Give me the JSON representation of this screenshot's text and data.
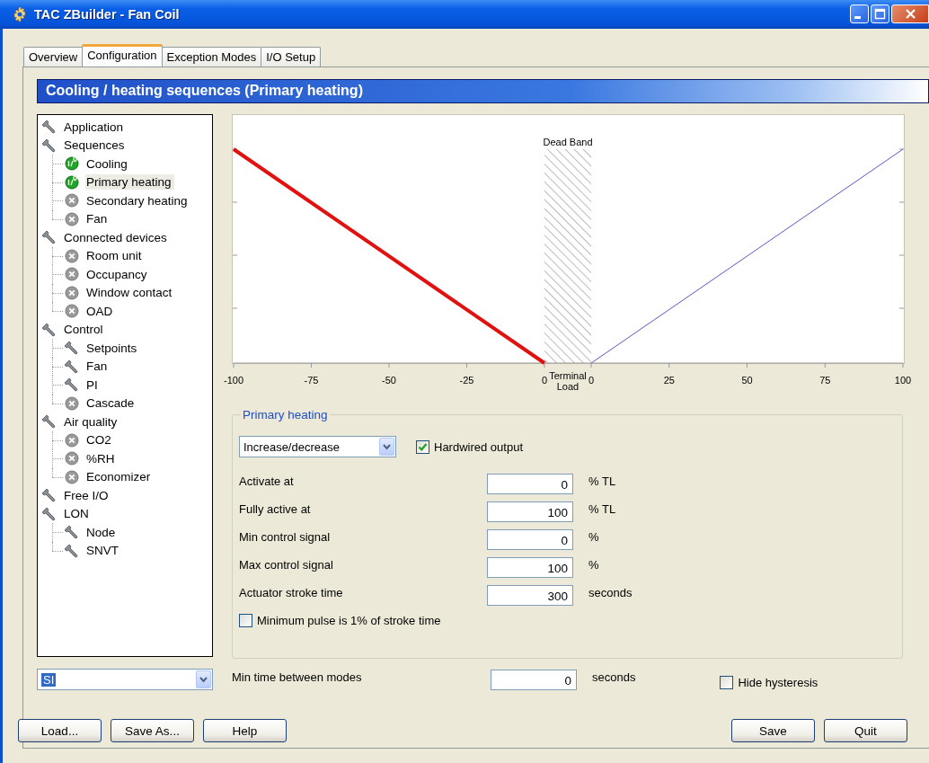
{
  "window": {
    "title": "TAC ZBuilder - Fan Coil"
  },
  "tabs": [
    {
      "label": "Overview",
      "selected": false
    },
    {
      "label": "Configuration",
      "selected": true
    },
    {
      "label": "Exception Modes",
      "selected": false
    },
    {
      "label": "I/O Setup",
      "selected": false
    }
  ],
  "section_header": "Cooling / heating sequences (Primary heating)",
  "tree": [
    {
      "label": "Application",
      "kind": "wrench",
      "selected": false
    },
    {
      "label": "Sequences",
      "kind": "wrench",
      "selected": false,
      "children": [
        {
          "label": "Cooling",
          "kind": "active",
          "selected": false
        },
        {
          "label": "Primary heating",
          "kind": "active",
          "selected": true
        },
        {
          "label": "Secondary heating",
          "kind": "inactive",
          "selected": false
        },
        {
          "label": "Fan",
          "kind": "inactive",
          "selected": false
        }
      ]
    },
    {
      "label": "Connected devices",
      "kind": "wrench",
      "selected": false,
      "children": [
        {
          "label": "Room unit",
          "kind": "inactive",
          "selected": false
        },
        {
          "label": "Occupancy",
          "kind": "inactive",
          "selected": false
        },
        {
          "label": "Window contact",
          "kind": "inactive",
          "selected": false
        },
        {
          "label": "OAD",
          "kind": "inactive",
          "selected": false
        }
      ]
    },
    {
      "label": "Control",
      "kind": "wrench",
      "selected": false,
      "children": [
        {
          "label": "Setpoints",
          "kind": "wrench",
          "selected": false
        },
        {
          "label": "Fan",
          "kind": "wrench",
          "selected": false
        },
        {
          "label": "PI",
          "kind": "wrench",
          "selected": false
        },
        {
          "label": "Cascade",
          "kind": "inactive",
          "selected": false
        }
      ]
    },
    {
      "label": "Air quality",
      "kind": "wrench",
      "selected": false,
      "children": [
        {
          "label": "CO2",
          "kind": "inactive",
          "selected": false
        },
        {
          "label": "%RH",
          "kind": "inactive",
          "selected": false
        },
        {
          "label": "Economizer",
          "kind": "inactive",
          "selected": false
        }
      ]
    },
    {
      "label": "Free I/O",
      "kind": "wrench",
      "selected": false
    },
    {
      "label": "LON",
      "kind": "wrench",
      "selected": false,
      "children": [
        {
          "label": "Node",
          "kind": "wrench",
          "selected": false
        },
        {
          "label": "SNVT",
          "kind": "wrench",
          "selected": false
        }
      ]
    }
  ],
  "chart": {
    "dead_band_label": "Dead Band",
    "terminal_load_label": "Terminal Load",
    "left_ticks": [
      "-100",
      "-75",
      "-50",
      "-25",
      "0"
    ],
    "right_ticks": [
      "0",
      "25",
      "50",
      "75",
      "100"
    ]
  },
  "group": {
    "title": "Primary heating",
    "mode_select": {
      "value": "Increase/decrease"
    },
    "hardwired_output": {
      "label": "Hardwired output",
      "checked": true
    },
    "fields": [
      {
        "label": "Activate at",
        "value": "0",
        "unit": "% TL"
      },
      {
        "label": "Fully active at",
        "value": "100",
        "unit": "% TL"
      },
      {
        "label": "Min control signal",
        "value": "0",
        "unit": "%"
      },
      {
        "label": "Max control signal",
        "value": "100",
        "unit": "%"
      },
      {
        "label": "Actuator stroke time",
        "value": "300",
        "unit": "seconds"
      }
    ],
    "min_pulse": {
      "label": "Minimum pulse is 1% of stroke time",
      "checked": false
    }
  },
  "unit_select": {
    "value": "SI",
    "text_selected": true
  },
  "min_time": {
    "label": "Min time between modes",
    "value": "0",
    "unit": "seconds"
  },
  "hide_hysteresis": {
    "label": "Hide hysteresis",
    "checked": false
  },
  "buttons_left": [
    "Load...",
    "Save As...",
    "Help"
  ],
  "buttons_right": [
    "Save",
    "Quit"
  ]
}
